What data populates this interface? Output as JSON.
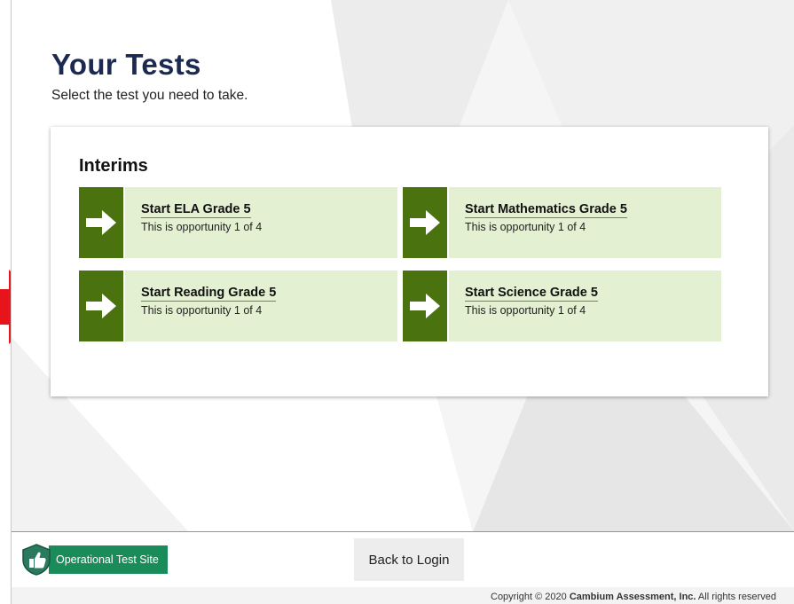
{
  "header": {
    "title": "Your Tests",
    "subtitle": "Select the test you need to take."
  },
  "section": {
    "title": "Interims"
  },
  "tests": [
    {
      "label": "Start ELA Grade 5",
      "detail": "This is opportunity 1 of 4"
    },
    {
      "label": "Start Mathematics Grade 5",
      "detail": "This is opportunity 1 of 4"
    },
    {
      "label": "Start Reading Grade 5",
      "detail": "This is opportunity 1 of 4"
    },
    {
      "label": "Start Science Grade 5",
      "detail": "This is opportunity 1 of 4"
    }
  ],
  "footer": {
    "site_label": "Operational Test Site",
    "back_label": "Back to Login",
    "copyright_prefix": "Copyright © 2020 ",
    "copyright_company": "Cambium Assessment, Inc.",
    "copyright_suffix": " All rights reserved"
  },
  "icons": {
    "tile_arrow": "right-arrow-icon",
    "site_badge": "shield-thumbs-up-icon",
    "annotation": "red-pointer-arrow-icon"
  },
  "colors": {
    "title": "#1c2a52",
    "tile_arrow_bg": "#4a7310",
    "tile_bg": "#e3f0d2",
    "site_badge_bg": "#1a8c5a",
    "annotation_arrow": "#e8141b"
  }
}
